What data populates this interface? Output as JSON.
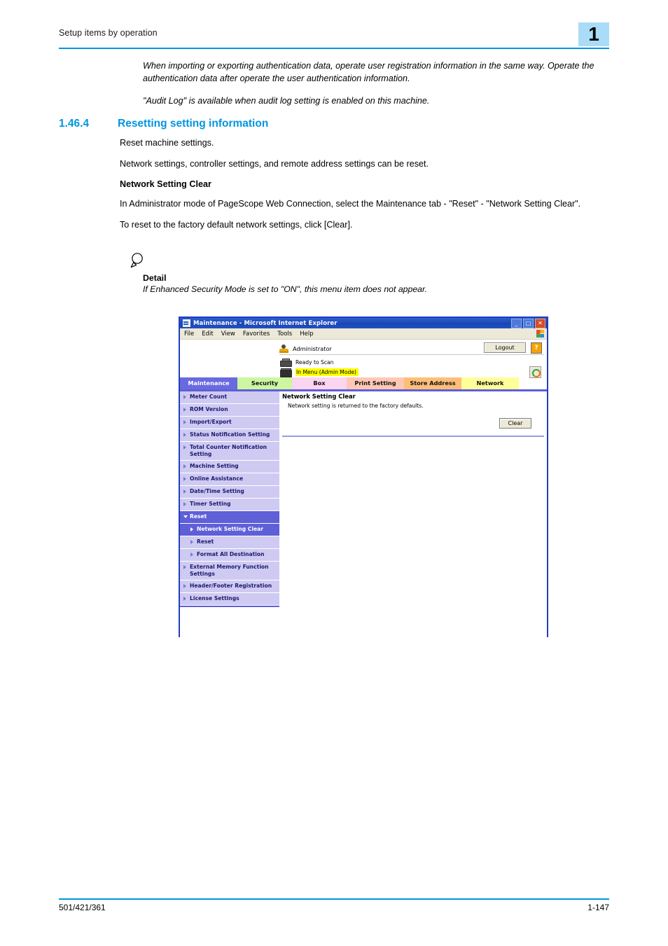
{
  "header": {
    "running_title": "Setup items by operation",
    "chapter_number": "1",
    "accent_color": "#0096e0",
    "badge_color": "#aadcf7"
  },
  "intro": {
    "paragraphs": [
      "When importing or exporting authentication data, operate user registration information in the same way. Operate the authentication data after operate the user authentication information.",
      "\"Audit Log\" is available when audit log setting is enabled on this machine."
    ]
  },
  "section": {
    "number": "1.46.4",
    "title": "Resetting setting information",
    "paragraph1": "Reset machine settings.",
    "paragraph2": "Network settings, controller settings, and remote address settings can be reset.",
    "subhead": "Network Setting Clear",
    "paragraph3": "In Administrator mode of PageScope Web Connection, select the Maintenance tab - \"Reset\" - \"Network Setting Clear\".",
    "paragraph4": "To reset to the factory default network settings, click [Clear]."
  },
  "detail": {
    "icon": "magnifier-icon",
    "label": "Detail",
    "body": "If Enhanced Security Mode is set to \"ON\", this menu item does not appear."
  },
  "browser": {
    "title": "Maintenance - Microsoft Internet Explorer",
    "window_buttons": {
      "minimize": "_",
      "maximize": "□",
      "close": "✕"
    },
    "menu": [
      "File",
      "Edit",
      "View",
      "Favorites",
      "Tools",
      "Help"
    ],
    "page": {
      "user_name": "Administrator",
      "logout_label": "Logout",
      "help_label": "?",
      "status": [
        {
          "icon": "scanner-icon",
          "text": "Ready to Scan",
          "highlighted": false
        },
        {
          "icon": "copier-icon",
          "text": "In Menu (Admin Mode)",
          "highlighted": true
        }
      ],
      "refresh_icon": "refresh-icon",
      "tabs": [
        {
          "label": "Maintenance",
          "color": "#6a6ae0",
          "active": true
        },
        {
          "label": "Security",
          "color": "#ccf6a0",
          "active": false
        },
        {
          "label": "Box",
          "color": "#fbd4f0",
          "active": false
        },
        {
          "label": "Print Setting",
          "color": "#ffc8b4",
          "active": false
        },
        {
          "label": "Store Address",
          "color": "#ffbe78",
          "active": false
        },
        {
          "label": "Network",
          "color": "#ffff99",
          "active": false
        }
      ],
      "sidebar": [
        {
          "label": "Meter Count",
          "type": "item"
        },
        {
          "label": "ROM Version",
          "type": "item"
        },
        {
          "label": "Import/Export",
          "type": "item"
        },
        {
          "label": "Status Notification Setting",
          "type": "item"
        },
        {
          "label": "Total Counter Notification Setting",
          "type": "item"
        },
        {
          "label": "Machine Setting",
          "type": "item"
        },
        {
          "label": "Online Assistance",
          "type": "item"
        },
        {
          "label": "Date/Time Setting",
          "type": "item"
        },
        {
          "label": "Timer Setting",
          "type": "item"
        },
        {
          "label": "Reset",
          "type": "group"
        },
        {
          "label": "Network Setting Clear",
          "type": "sub-selected"
        },
        {
          "label": "Reset",
          "type": "sub"
        },
        {
          "label": "Format All Destination",
          "type": "sub"
        },
        {
          "label": "External Memory Function Settings",
          "type": "item"
        },
        {
          "label": "Header/Footer Registration",
          "type": "item"
        },
        {
          "label": "License Settings",
          "type": "item"
        }
      ],
      "content": {
        "title": "Network Setting Clear",
        "description": "Network setting is returned to the factory defaults.",
        "clear_label": "Clear"
      }
    }
  },
  "footer": {
    "left": "501/421/361",
    "right": "1-147"
  }
}
